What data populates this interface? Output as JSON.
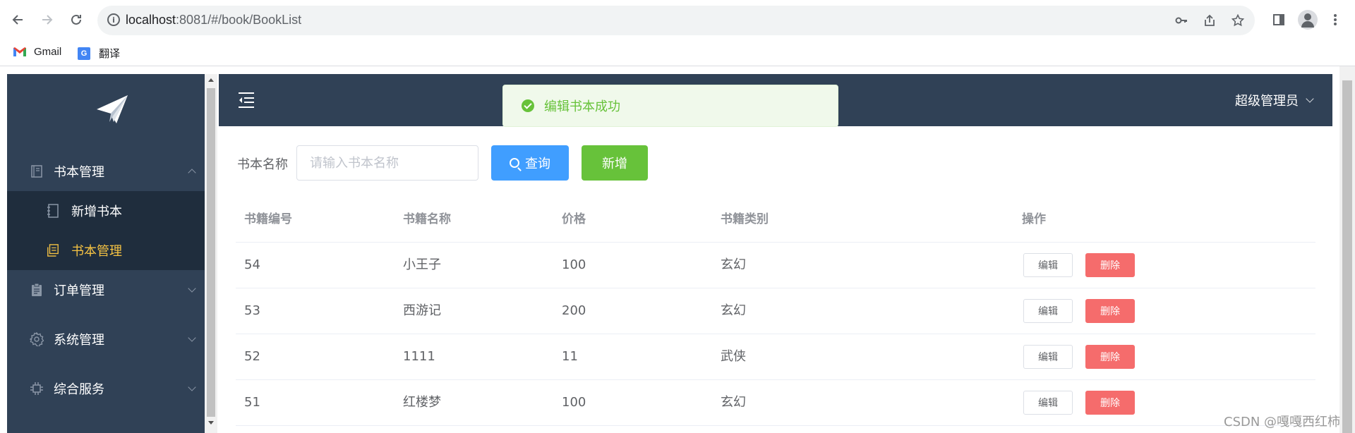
{
  "browser": {
    "url_host": "localhost",
    "url_rest": ":8081/#/book/BookList",
    "bookmarks": [
      {
        "label": "Gmail",
        "icon": "gmail-icon"
      },
      {
        "label": "翻译",
        "icon": "translate-icon"
      }
    ]
  },
  "sidebar": {
    "logo_icon": "paper-plane-icon",
    "items": [
      {
        "label": "书本管理",
        "icon": "book-icon",
        "expanded": true
      },
      {
        "label": "订单管理",
        "icon": "clipboard-icon",
        "expanded": false
      },
      {
        "label": "系统管理",
        "icon": "gear-icon",
        "expanded": false
      },
      {
        "label": "综合服务",
        "icon": "chip-icon",
        "expanded": false
      }
    ],
    "sub_items": [
      {
        "label": "新增书本",
        "icon": "notebook-icon",
        "active": false
      },
      {
        "label": "书本管理",
        "icon": "document-copy-icon",
        "active": true
      }
    ]
  },
  "header": {
    "user_label": "超级管理员"
  },
  "toast": {
    "message": "编辑书本成功"
  },
  "search": {
    "label": "书本名称",
    "placeholder": "请输入书本名称",
    "value": "",
    "query_button": "查询",
    "add_button": "新增"
  },
  "table": {
    "columns": [
      "书籍编号",
      "书籍名称",
      "价格",
      "书籍类别",
      "操作"
    ],
    "rows": [
      {
        "id": "54",
        "name": "小王子",
        "price": "100",
        "category": "玄幻",
        "edit": "编辑",
        "delete": "删除"
      },
      {
        "id": "53",
        "name": "西游记",
        "price": "200",
        "category": "玄幻",
        "edit": "编辑",
        "delete": "删除"
      },
      {
        "id": "52",
        "name": "1111",
        "price": "11",
        "category": "武侠",
        "edit": "编辑",
        "delete": "删除"
      },
      {
        "id": "51",
        "name": "红楼梦",
        "price": "100",
        "category": "玄幻",
        "edit": "编辑",
        "delete": "删除"
      }
    ]
  },
  "watermark": "CSDN @嘎嘎西红柿",
  "colors": {
    "sidebar_bg": "#304156",
    "active_menu": "#f6c343",
    "primary": "#409eff",
    "success": "#67c23a",
    "danger": "#f56c6c"
  }
}
